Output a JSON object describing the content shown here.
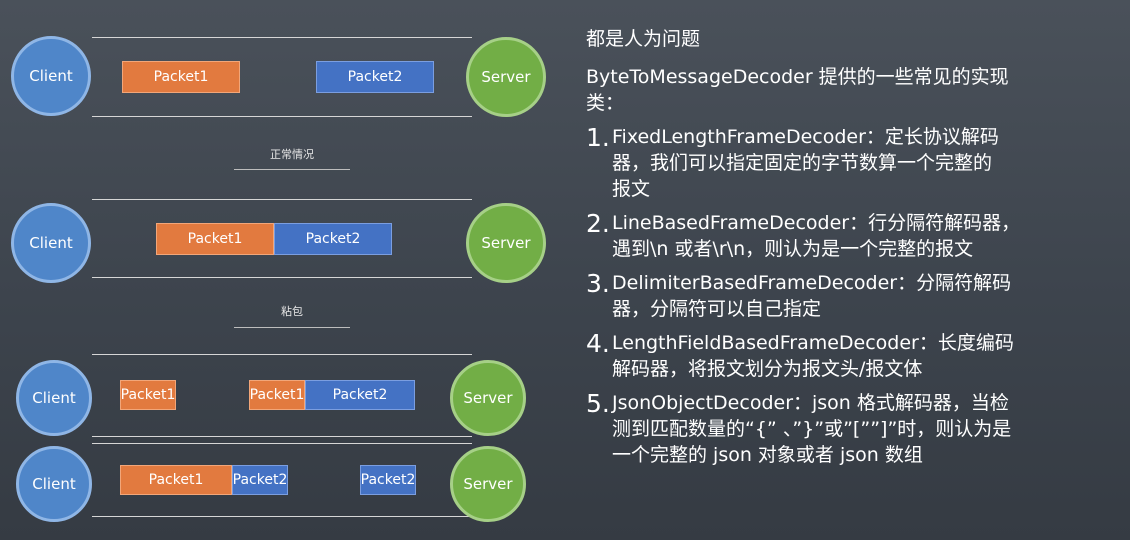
{
  "diagram": {
    "client_label": "Client",
    "server_label": "Server",
    "packet1": "Packet1",
    "packet2": "Packet2",
    "caption_normal": "正常情况",
    "caption_sticky": "粘包"
  },
  "text_panel": {
    "heading": "都是人为问题",
    "intro_line1": "ByteToMessageDecoder 提供的一些常见的实现",
    "intro_line2": "类：",
    "items": [
      {
        "num": "1.",
        "line1": "FixedLengthFrameDecoder：定长协议解码",
        "line2": "器，我们可以指定固定的字节数算一个完整的",
        "line3": "报文"
      },
      {
        "num": "2.",
        "line1": "LineBasedFrameDecoder：行分隔符解码器，",
        "line2": "遇到\\n 或者\\r\\n，则认为是一个完整的报文"
      },
      {
        "num": "3.",
        "line1": "DelimiterBasedFrameDecoder：分隔符解码",
        "line2": "器，分隔符可以自己指定"
      },
      {
        "num": "4.",
        "line1": "LengthFieldBasedFrameDecoder：长度编码",
        "line2": "解码器，将报文划分为报文头/报文体"
      },
      {
        "num": "5.",
        "line1": "JsonObjectDecoder：json 格式解码器，当检",
        "line2": "测到匹配数量的“{” 、”}”或”[””]”时，则认为是",
        "line3": "一个完整的 json 对象或者 json 数组"
      }
    ]
  }
}
